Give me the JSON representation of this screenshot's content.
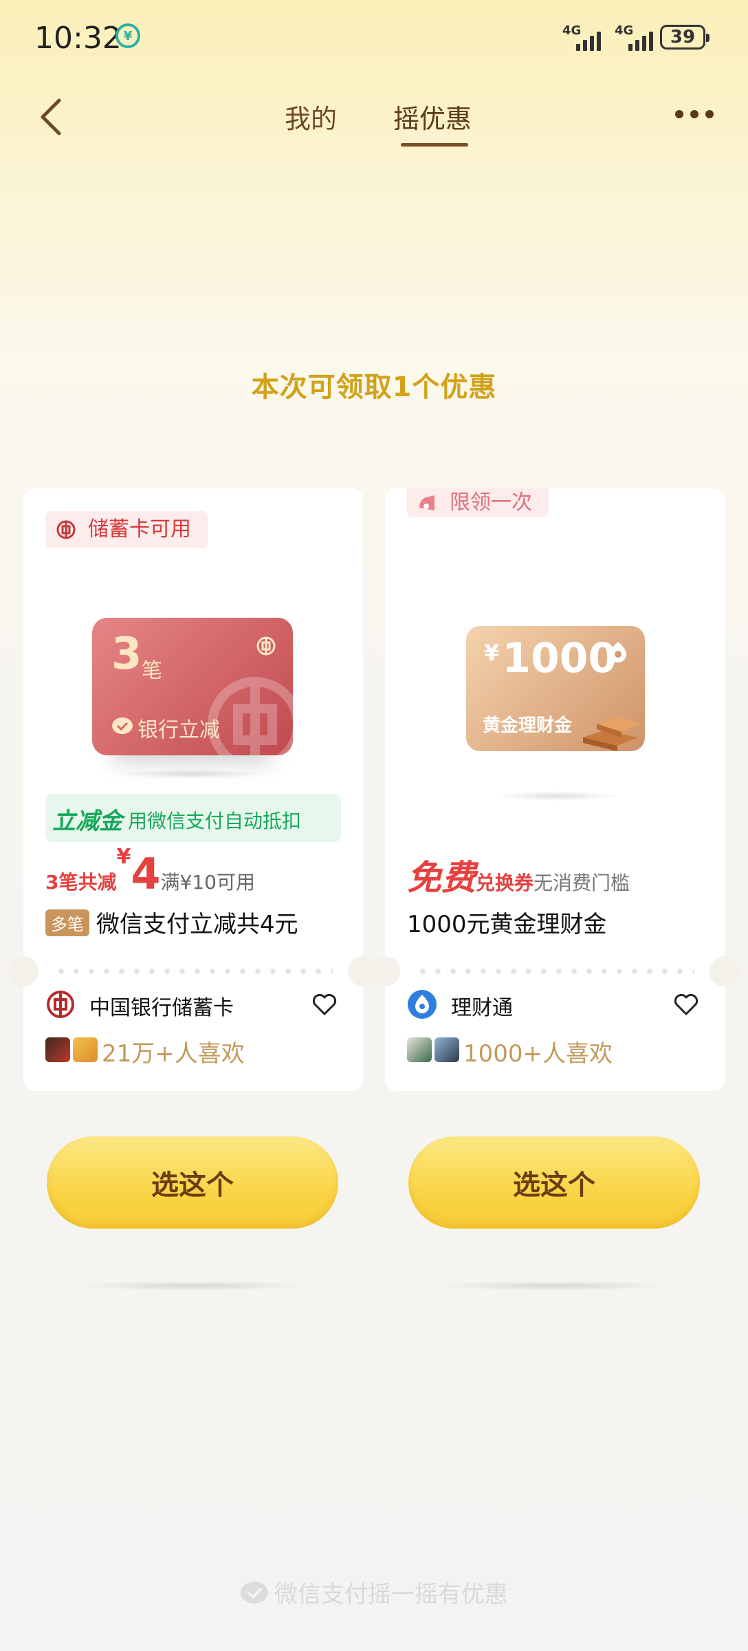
{
  "status_bar": {
    "time": "10:32",
    "signal1_label": "4G",
    "signal2_label": "4G",
    "battery": "39"
  },
  "nav": {
    "tabs": [
      {
        "label": "我的",
        "active": false
      },
      {
        "label": "摇优惠",
        "active": true
      }
    ]
  },
  "headline": "本次可领取1个优惠",
  "cards": [
    {
      "tag": "储蓄卡可用",
      "card_visual": {
        "count": "3",
        "count_unit": "笔",
        "label": "银行立减"
      },
      "lijian_badge": "立减金",
      "lijian_text": "用微信支付自动抵扣",
      "price_prefix": "3笔共减",
      "currency": "¥",
      "amount": "4",
      "condition": "满¥10可用",
      "title_badge": "多笔",
      "title": "微信支付立减共4元",
      "merchant": "中国银行储蓄卡",
      "likes": "21万+人喜欢",
      "button": "选这个"
    },
    {
      "tag": "限领一次",
      "card_visual": {
        "currency": "¥",
        "amount": "1000",
        "label": "黄金理财金"
      },
      "free_label": "免费",
      "voucher_label": "兑换券",
      "threshold": "无消费门槛",
      "title": "1000元黄金理财金",
      "merchant": "理财通",
      "likes": "1000+人喜欢",
      "button": "选这个"
    }
  ],
  "footer": "微信支付摇一摇有优惠",
  "colors": {
    "accent_gold": "#d1a21a",
    "price_red": "#e5413f",
    "green": "#16a95a",
    "button_yellow": "#fad546",
    "button_text": "#6a3e12"
  }
}
